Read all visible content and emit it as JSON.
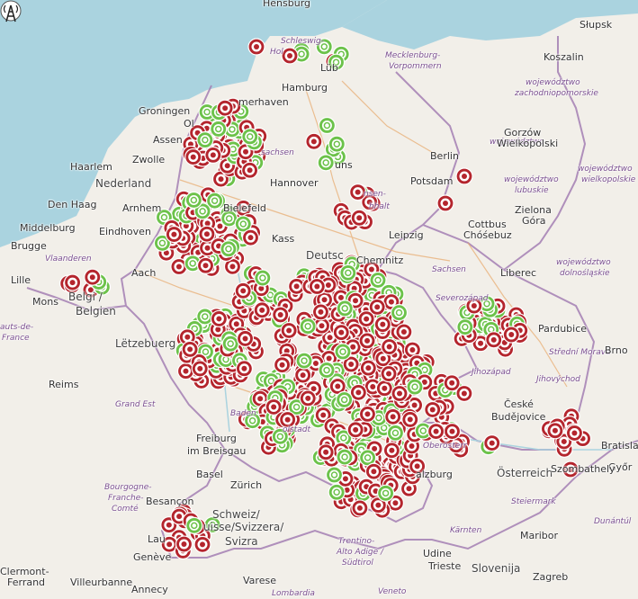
{
  "colors": {
    "sea": "#aad3df",
    "land": "#f2efe9",
    "border": "#a47fb3",
    "road": "#e8a96b",
    "marker_red": "#b4252d",
    "marker_green": "#6cc24a"
  },
  "labels": {
    "hamburg": "Hamburg",
    "hannover": "Hannover",
    "berlin": "Berlin",
    "potsdam": "Potsdam",
    "leipzig": "Leipzig",
    "chemnitz": "Chemnitz",
    "bielefeld": "Bielefeld",
    "kassel": "Kass",
    "deutsch": "Deutsc",
    "groningen": "Groningen",
    "assen": "Assen",
    "haarlem": "Haarlem",
    "zwolle": "Zwolle",
    "nederland": "Nederland",
    "den_haag": "Den Haag",
    "arnhem": "Arnhem",
    "middelburg": "Middelburg",
    "eindhoven": "Eindhoven",
    "brugge": "Brugge",
    "vlaanderen": "Vlaanderen",
    "lille": "Lille",
    "mons": "Mons",
    "belgien": "Belgi    /",
    "belgien2": "Belgien",
    "aach": "Aach",
    "letzebuerg": "Lëtzebuerg",
    "hauts": "auts-de-",
    "france": "France",
    "reims": "Reims",
    "grand_est": "Grand Est",
    "baden": "Baden",
    "freiburg": "Freiburg",
    "breisgau": "im Breisgau",
    "basel": "Basel",
    "zurich": "Zürich",
    "besancon": "Besançon",
    "bourgogne": "Bourgogne-",
    "franche": "Franche-",
    "comte": "Comté",
    "schweiz": "Schweiz/",
    "suisse": "uisse/Svizzera/",
    "svizra": "Svizra",
    "geneve": "Genève",
    "laus": "Lau",
    "clermont": "Clermont-",
    "ferrand": "Ferrand",
    "villeurbanne": "Villeurbanne",
    "annecy": "Annecy",
    "varese": "Varese",
    "lombardia": "Lombardia",
    "trentino": "Trentino-",
    "alto_adige": "Alto Adige /",
    "sudtirol": "Südtirol",
    "udine": "Udine",
    "veneto": "Veneto",
    "trieste": "Trieste",
    "slovenija": "Slovenija",
    "zagreb": "Zagreb",
    "karnten": "Kärnten",
    "steiermark": "Steiermark",
    "maribor": "Maribor",
    "osterreich": "Österreich",
    "salzburg": "alzburg",
    "szombathely": "Szombathely",
    "bratislava": "Bratisla",
    "gyor": "Győr",
    "dunantul": "Dunántúl",
    "ceske": "České",
    "budejovice": "Budějovice",
    "jihocesky": "Jihočeský",
    "jihozapad": "Jihozápad",
    "severozapad": "Severozápad",
    "pardubice": "Pardubice",
    "stredni_morava": "Střední Morava",
    "brno": "Brno",
    "jihovychod": "Jihovýchod",
    "liberec": "Liberec",
    "cottbus": "Cottbus",
    "chosebuz": "Chóśebuz",
    "zielona": "Zielona",
    "gora": "Góra",
    "wojewodztwo_lubuskie1": "województwo",
    "wojewodztwo_lubuskie2": "lubuskie",
    "wojewodztwo_ws1": "województwo",
    "wojewodztwo_ws2": "wielkopolskie",
    "wojewodztwo_ds1": "województwo",
    "wojewodztwo_ds2": "dolnośląskie",
    "wojewodztwo_zp1": "województwo",
    "wojewodztwo_zp2": "zachodniopomorskie",
    "gorzow": "Gorzów",
    "wielkopolski": "Wielkopolski",
    "koszalin": "Koszalin",
    "slupsk": "Słupsk",
    "schleswig": "Schleswig-",
    "holstein": "Hol",
    "lub": "Lüb",
    "mecklenburg": "Mecklenburg-",
    "vorpommern": "Vorpommern",
    "sachsen": "Sachsen",
    "sachsen_anhalt": "nsen-",
    "anhalt": "hhalt",
    "ostbayern": "Oberösterr",
    "ol": "Ol",
    "mhaven": "merhaven",
    "sachsen2": "sachsen",
    "hensburg": "Hensburg",
    "ruins": "uns",
    "oplstadt": "olstadt",
    "mun": "Mün",
    "rg": "rg"
  },
  "markers_description": "Clusters of red target markers and green circle markers over Germany, Netherlands, Belgium, Switzerland, Austria, Czechia; an antenna tower icon in central Germany"
}
